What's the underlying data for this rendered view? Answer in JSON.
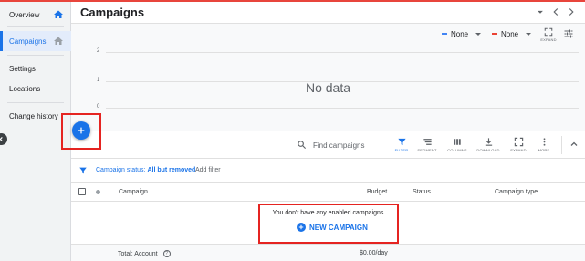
{
  "sidebar": {
    "items": [
      {
        "label": "Overview"
      },
      {
        "label": "Campaigns"
      },
      {
        "label": "Settings"
      },
      {
        "label": "Locations"
      },
      {
        "label": "Change history"
      }
    ]
  },
  "header": {
    "title": "Campaigns"
  },
  "chart": {
    "metric1": {
      "label": "None",
      "color": "#4285f4"
    },
    "metric2": {
      "label": "None",
      "color": "#ea4335"
    },
    "expand_label": "EXPAND",
    "y_ticks": [
      "2",
      "1",
      "0"
    ],
    "empty_message": "No data"
  },
  "toolbar": {
    "search_placeholder": "Find campaigns",
    "tools": [
      {
        "label": "FILTER",
        "icon": "filter-icon"
      },
      {
        "label": "SEGMENT",
        "icon": "segment-icon"
      },
      {
        "label": "COLUMNS",
        "icon": "columns-icon"
      },
      {
        "label": "DOWNLOAD",
        "icon": "download-icon"
      },
      {
        "label": "EXPAND",
        "icon": "expand-icon"
      },
      {
        "label": "MORE",
        "icon": "more-vert-icon"
      }
    ]
  },
  "filter": {
    "chip_prefix": "Campaign status:",
    "chip_value": "All but removed",
    "add_filter": "Add filter"
  },
  "table": {
    "columns": [
      "Campaign",
      "Budget",
      "Status",
      "Campaign type"
    ]
  },
  "empty_state": {
    "message": "You don't have any enabled campaigns",
    "cta_label": "NEW CAMPAIGN"
  },
  "footer": {
    "total_label": "Total: Account",
    "total_budget": "$0.00/day"
  },
  "colors": {
    "accent": "#1a73e8",
    "annotation_red": "#e52421"
  }
}
